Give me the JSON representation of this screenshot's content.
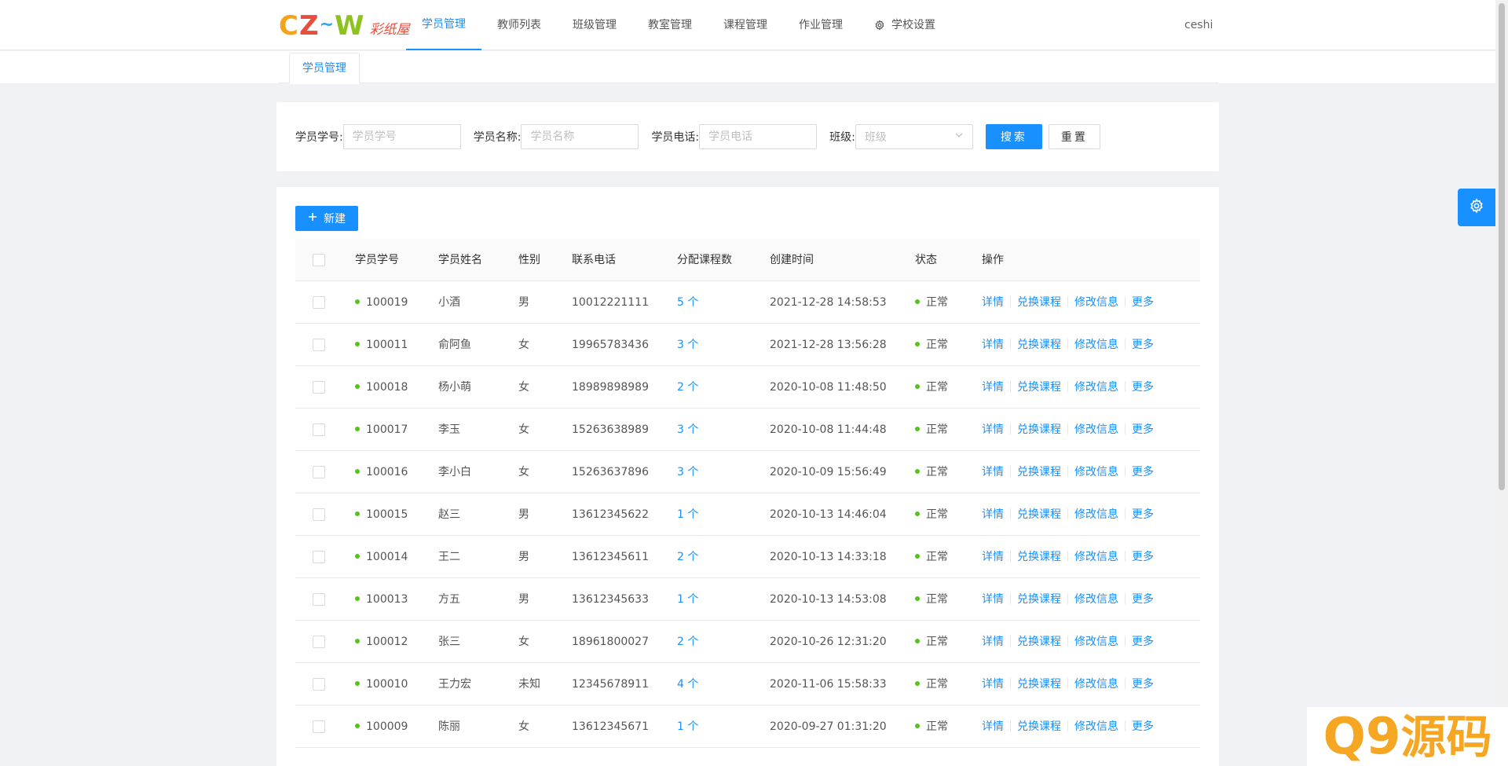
{
  "header": {
    "logo_mark": [
      "C",
      "Z",
      "~",
      "W"
    ],
    "logo_text": "彩纸屋",
    "nav": [
      {
        "label": "学员管理",
        "active": true
      },
      {
        "label": "教师列表"
      },
      {
        "label": "班级管理"
      },
      {
        "label": "教室管理"
      },
      {
        "label": "课程管理"
      },
      {
        "label": "作业管理"
      },
      {
        "label": "学校设置",
        "icon": "gear-icon"
      }
    ],
    "user": "ceshi"
  },
  "tabs": [
    {
      "label": "学员管理"
    }
  ],
  "search": {
    "student_id_label": "学员学号:",
    "student_id_placeholder": "学员学号",
    "student_name_label": "学员名称:",
    "student_name_placeholder": "学员名称",
    "phone_label": "学员电话:",
    "phone_placeholder": "学员电话",
    "class_label": "班级:",
    "class_placeholder": "班级",
    "search_button": "搜索",
    "reset_button": "重置"
  },
  "table": {
    "new_button": "新建",
    "columns": [
      "学员学号",
      "学员姓名",
      "性别",
      "联系电话",
      "分配课程数",
      "创建时间",
      "状态",
      "操作"
    ],
    "actions": [
      "详情",
      "兑换课程",
      "修改信息",
      "更多"
    ],
    "rows": [
      {
        "id": "100019",
        "name": "小酒",
        "gender": "男",
        "phone": "10012221111",
        "courses": "5 个",
        "created": "2021-12-28 14:58:53",
        "status": "正常"
      },
      {
        "id": "100011",
        "name": "俞阿鱼",
        "gender": "女",
        "phone": "19965783436",
        "courses": "3 个",
        "created": "2021-12-28 13:56:28",
        "status": "正常"
      },
      {
        "id": "100018",
        "name": "杨小萌",
        "gender": "女",
        "phone": "18989898989",
        "courses": "2 个",
        "created": "2020-10-08 11:48:50",
        "status": "正常"
      },
      {
        "id": "100017",
        "name": "李玉",
        "gender": "女",
        "phone": "15263638989",
        "courses": "3 个",
        "created": "2020-10-08 11:44:48",
        "status": "正常"
      },
      {
        "id": "100016",
        "name": "李小白",
        "gender": "女",
        "phone": "15263637896",
        "courses": "3 个",
        "created": "2020-10-09 15:56:49",
        "status": "正常"
      },
      {
        "id": "100015",
        "name": "赵三",
        "gender": "男",
        "phone": "13612345622",
        "courses": "1 个",
        "created": "2020-10-13 14:46:04",
        "status": "正常"
      },
      {
        "id": "100014",
        "name": "王二",
        "gender": "男",
        "phone": "13612345611",
        "courses": "2 个",
        "created": "2020-10-13 14:33:18",
        "status": "正常"
      },
      {
        "id": "100013",
        "name": "方五",
        "gender": "男",
        "phone": "13612345633",
        "courses": "1 个",
        "created": "2020-10-13 14:53:08",
        "status": "正常"
      },
      {
        "id": "100012",
        "name": "张三",
        "gender": "女",
        "phone": "18961800027",
        "courses": "2 个",
        "created": "2020-10-26 12:31:20",
        "status": "正常"
      },
      {
        "id": "100010",
        "name": "王力宏",
        "gender": "未知",
        "phone": "12345678911",
        "courses": "4 个",
        "created": "2020-11-06 15:58:33",
        "status": "正常"
      },
      {
        "id": "100009",
        "name": "陈丽",
        "gender": "女",
        "phone": "13612345671",
        "courses": "1 个",
        "created": "2020-09-27 01:31:20",
        "status": "正常"
      }
    ]
  },
  "watermark": {
    "q": "Q",
    "nine": "9",
    "text": "源码"
  },
  "colors": {
    "primary": "#1890ff",
    "success": "#52c41a",
    "watermark": "#f5a623"
  }
}
